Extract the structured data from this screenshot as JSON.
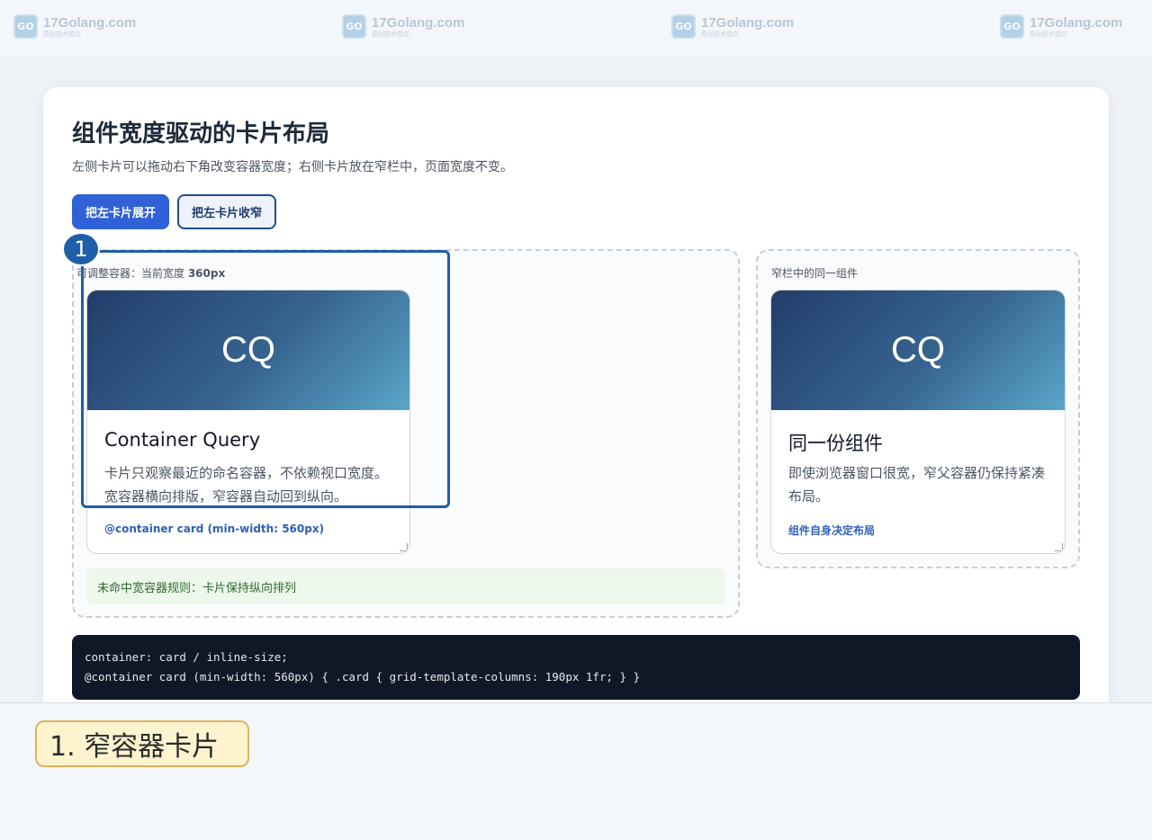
{
  "watermark": {
    "name": "17Golang.com",
    "sub": "原创技术图文",
    "icon": "golang-logo-icon"
  },
  "header": {
    "title": "组件宽度驱动的卡片布局",
    "subtitle": "左侧卡片可以拖动右下角改变容器宽度；右侧卡片放在窄栏中，页面宽度不变。"
  },
  "toolbar": {
    "expand_label": "把左卡片展开",
    "shrink_label": "把左卡片收窄"
  },
  "resizable": {
    "label_prefix": "可调整容器：当前宽度 ",
    "label_width": "360px",
    "card": {
      "hero": "CQ",
      "title": "Container Query",
      "desc": "卡片只观察最近的命名容器，不依赖视口宽度。宽容器横向排版，窄容器自动回到纵向。",
      "link": "@container card (min-width: 560px)"
    },
    "status": "未命中宽容器规则：卡片保持纵向排列"
  },
  "narrow": {
    "label": "窄栏中的同一组件",
    "card": {
      "hero": "CQ",
      "title": "同一份组件",
      "desc": "即使浏览器窗口很宽，窄父容器仍保持紧凑布局。",
      "link": "组件自身决定布局"
    }
  },
  "code": {
    "line1": "container: card / inline-size;",
    "line2": "@container card (min-width: 560px) { .card { grid-template-columns: 190px 1fr; } }"
  },
  "annotation": {
    "badge": "1",
    "caption": "1. 窄容器卡片"
  },
  "colors": {
    "accent": "#2f62d6",
    "annotation": "#1f5ea8",
    "status_bg": "#eef7ec"
  }
}
